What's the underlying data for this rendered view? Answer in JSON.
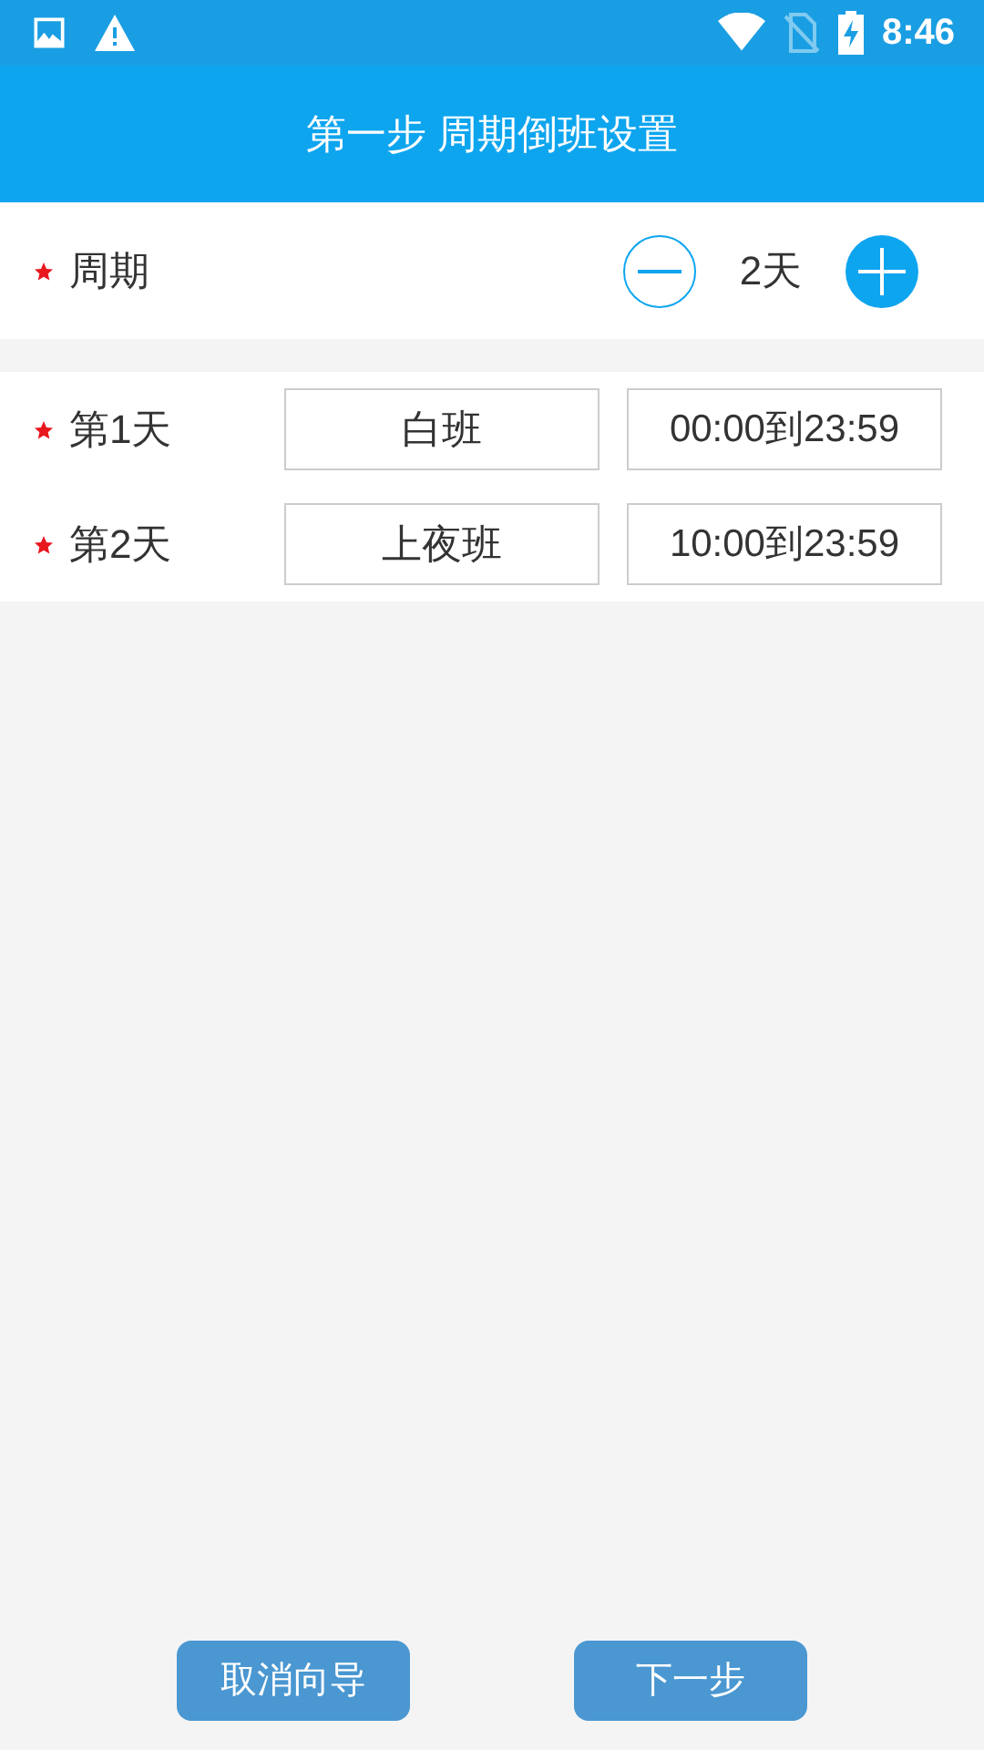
{
  "status_bar": {
    "time": "8:46"
  },
  "header": {
    "title": "第一步 周期倒班设置"
  },
  "period": {
    "label": "周期",
    "required": true,
    "value": "2天"
  },
  "days": [
    {
      "label": "第1天",
      "required": true,
      "shift": "白班",
      "time": "00:00到23:59"
    },
    {
      "label": "第2天",
      "required": true,
      "shift": "上夜班",
      "time": "10:00到23:59"
    }
  ],
  "buttons": [
    {
      "label": "取消向导"
    },
    {
      "label": "下一步"
    }
  ]
}
